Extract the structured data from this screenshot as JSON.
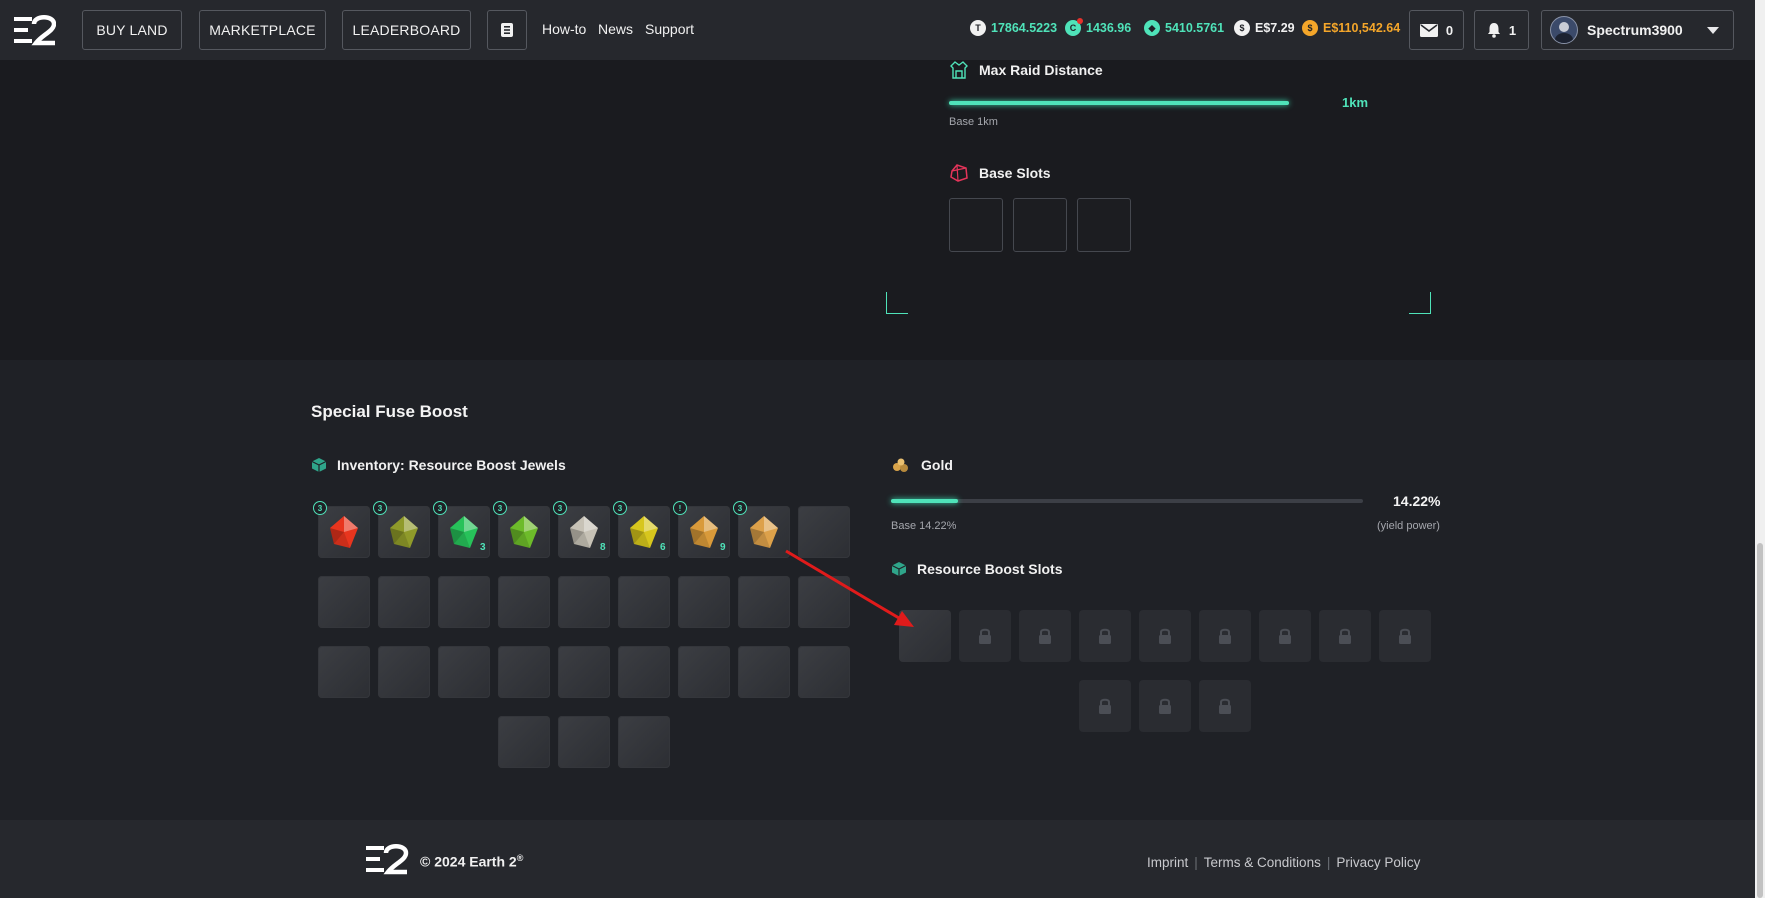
{
  "nav": {
    "buy_land": "BUY LAND",
    "marketplace": "MARKETPLACE",
    "leaderboard": "LEADERBOARD",
    "how_to": "How-to",
    "news": "News",
    "support": "Support"
  },
  "balances": {
    "tokens": "17864.5223",
    "civilians": "1436.96",
    "ether": "5410.5761",
    "cash": "E$7.29",
    "essence": "E$110,542.64"
  },
  "header": {
    "mail_count": "0",
    "notif_count": "1",
    "username": "Spectrum3900"
  },
  "raid": {
    "label": "Max Raid Distance",
    "value": "1km",
    "base": "Base 1km",
    "fill_fraction": 1.0
  },
  "base_slots": {
    "label": "Base Slots"
  },
  "fuse": {
    "title": "Special Fuse Boost",
    "inventory_label": "Inventory: Resource Boost Jewels",
    "jewels": [
      {
        "badge": "3",
        "qty": "",
        "color": "#e8351e"
      },
      {
        "badge": "3",
        "qty": "",
        "color": "#8f9a2a"
      },
      {
        "badge": "3",
        "qty": "3",
        "color": "#27c25a"
      },
      {
        "badge": "3",
        "qty": "",
        "color": "#6dbb2a"
      },
      {
        "badge": "3",
        "qty": "8",
        "color": "#c7c2b6"
      },
      {
        "badge": "3",
        "qty": "6",
        "color": "#d7c61d"
      },
      {
        "badge": "!",
        "qty": "9",
        "color": "#d99a3a"
      },
      {
        "badge": "3",
        "qty": "",
        "color": "#dda14a"
      }
    ],
    "gold_label": "Gold",
    "gold_value": "14.22%",
    "gold_base": "Base 14.22%",
    "gold_note": "(yield power)",
    "gold_fill_fraction": 0.1422,
    "resource_slots_label": "Resource Boost Slots"
  },
  "footer": {
    "copyright": "© 2024 Earth 2",
    "trademark": "®",
    "imprint": "Imprint",
    "terms": "Terms & Conditions",
    "privacy": "Privacy Policy",
    "separator": "|"
  },
  "colors": {
    "accent": "#4fe3b9",
    "gold": "#f4a62a",
    "arrow": "#e01b1b"
  }
}
